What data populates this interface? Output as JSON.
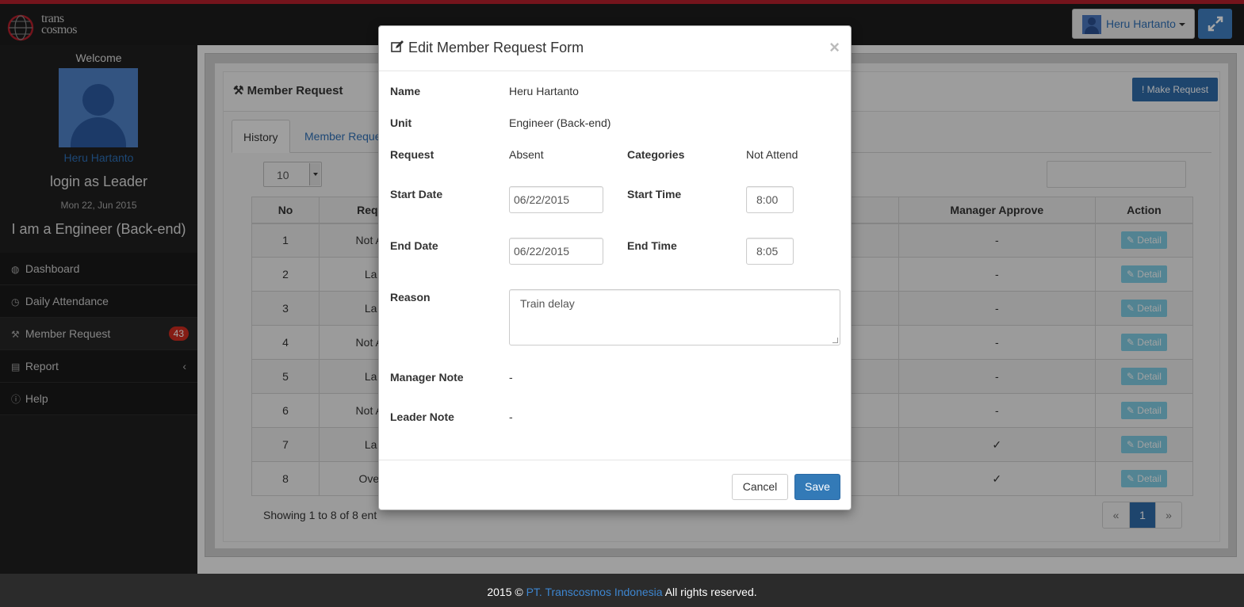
{
  "header": {
    "logo_text": "trans cosmos",
    "user_name": "Heru Hartanto",
    "expand_icon": "expand-icon"
  },
  "sidebar": {
    "welcome": "Welcome",
    "name": "Heru Hartanto",
    "role": "login as Leader",
    "date": "Mon 22, Jun 2015",
    "unit": "I am a Engineer (Back-end)",
    "menu": [
      {
        "label": "Dashboard",
        "icon": "dashboard-icon"
      },
      {
        "label": "Daily Attendance",
        "icon": "clock-icon"
      },
      {
        "label": "Member Request",
        "icon": "gavel-icon",
        "badge": "43"
      },
      {
        "label": "Report",
        "icon": "book-icon"
      },
      {
        "label": "Help",
        "icon": "info-icon"
      }
    ]
  },
  "panel": {
    "title": "Member Request",
    "make_request": "Make Request",
    "tabs": [
      "History",
      "Member Reque"
    ],
    "page_length": "10",
    "columns": [
      "No",
      "Requ",
      "Manager Approve",
      "Action"
    ],
    "rows": [
      {
        "no": "1",
        "req": "Not At",
        "mgr": "-",
        "action": "Detail"
      },
      {
        "no": "2",
        "req": "La",
        "mgr": "-",
        "action": "Detail"
      },
      {
        "no": "3",
        "req": "La",
        "mgr": "-",
        "action": "Detail"
      },
      {
        "no": "4",
        "req": "Not At",
        "mgr": "-",
        "action": "Detail"
      },
      {
        "no": "5",
        "req": "La",
        "mgr": "-",
        "action": "Detail"
      },
      {
        "no": "6",
        "req": "Not At",
        "mgr": "-",
        "action": "Detail"
      },
      {
        "no": "7",
        "req": "La",
        "mgr": "✓",
        "action": "Detail"
      },
      {
        "no": "8",
        "req": "Over",
        "mgr": "✓",
        "action": "Detail"
      }
    ],
    "showing": "Showing 1 to 8 of 8 ent",
    "pager": {
      "prev": "«",
      "current": "1",
      "next": "»"
    }
  },
  "modal": {
    "title": "Edit Member Request Form",
    "close": "×",
    "name_label": "Name",
    "name_value": "Heru Hartanto",
    "unit_label": "Unit",
    "unit_value": "Engineer (Back-end)",
    "request_label": "Request",
    "request_value": "Absent",
    "categories_label": "Categories",
    "categories_value": "Not Attend",
    "start_date_label": "Start Date",
    "start_date": "06/22/2015",
    "start_time_label": "Start Time",
    "start_time": "8:00",
    "end_date_label": "End Date",
    "end_date": "06/22/2015",
    "end_time_label": "End Time",
    "end_time": "8:05",
    "reason_label": "Reason",
    "reason": "Train delay",
    "manager_note_label": "Manager Note",
    "manager_note": "-",
    "leader_note_label": "Leader Note",
    "leader_note": "-",
    "cancel": "Cancel",
    "save": "Save"
  },
  "footer": {
    "prefix": "2015 ©",
    "company": "PT. Transcosmos Indonesia",
    "suffix": "All rights reserved."
  }
}
